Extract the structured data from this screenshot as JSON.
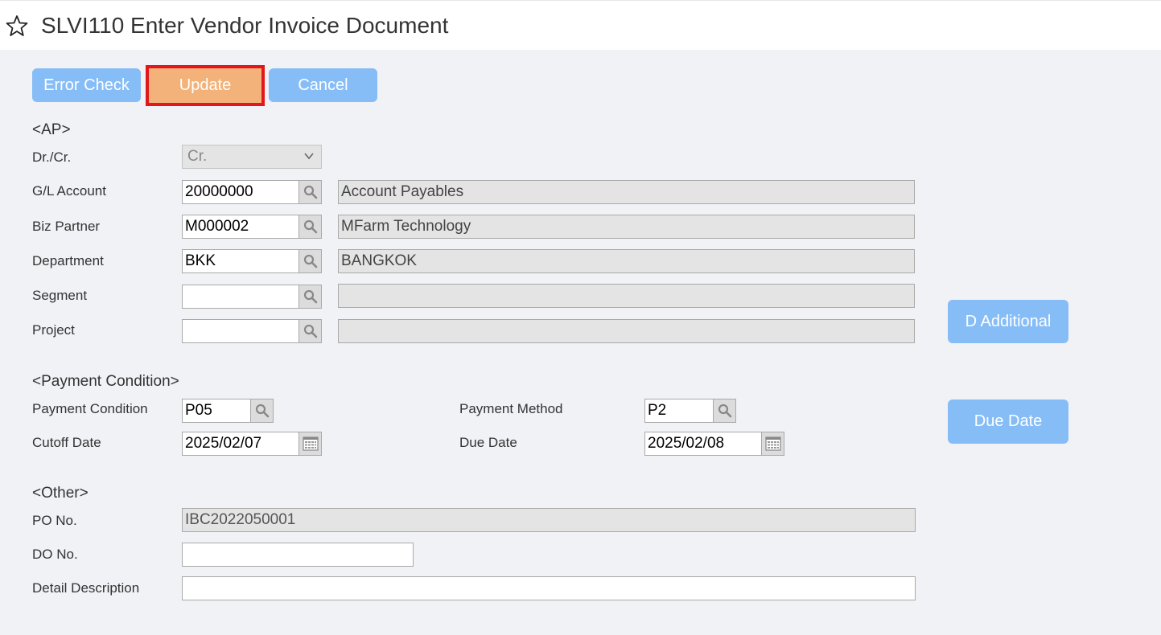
{
  "window": {
    "title": "SLVI110 Enter Vendor Invoice Document"
  },
  "toolbar": {
    "error_check": "Error Check",
    "update": "Update",
    "cancel": "Cancel"
  },
  "ap": {
    "heading": "<AP>",
    "drcr": {
      "label": "Dr./Cr.",
      "value": "Cr."
    },
    "gl_account": {
      "label": "G/L Account",
      "value": "20000000",
      "name": "Account Payables"
    },
    "biz_partner": {
      "label": "Biz Partner",
      "value": "M000002",
      "name": "MFarm Technology"
    },
    "department": {
      "label": "Department",
      "value": "BKK",
      "name": "BANGKOK"
    },
    "segment": {
      "label": "Segment",
      "value": "",
      "name": ""
    },
    "project": {
      "label": "Project",
      "value": "",
      "name": ""
    },
    "d_additional": "D Additional"
  },
  "payment": {
    "heading": "<Payment Condition>",
    "condition": {
      "label": "Payment Condition",
      "value": "P05"
    },
    "method": {
      "label": "Payment Method",
      "value": "P2"
    },
    "cutoff": {
      "label": "Cutoff Date",
      "value": "2025/02/07"
    },
    "due": {
      "label": "Due Date",
      "value": "2025/02/08"
    },
    "due_date_button": "Due Date"
  },
  "other": {
    "heading": "<Other>",
    "po_no": {
      "label": "PO No.",
      "value": "IBC2022050001"
    },
    "do_no": {
      "label": "DO No.",
      "value": ""
    },
    "detail": {
      "label": "Detail Description",
      "value": ""
    }
  },
  "colors": {
    "button_blue": "#86bdf7",
    "button_orange": "#f3b27a",
    "highlight_red": "#e3161b"
  },
  "icons": [
    "star-icon",
    "chevron-down-icon",
    "search-icon",
    "calendar-icon"
  ]
}
